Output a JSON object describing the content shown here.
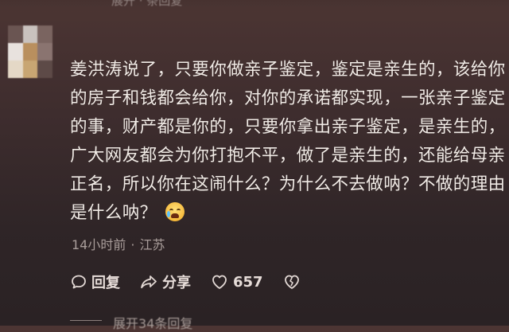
{
  "top_partial_text": "展开 · 条回复",
  "comment": {
    "lines": [
      "姜洪涛说了，只要你做亲子鉴定，鉴定是亲生的，该给你",
      "的房子和钱都会给你，对你的承诺都实现，一张亲子鉴定",
      "的事，财产都是你的，只要你拿出亲子鉴定，是亲生的，",
      "广大网友都会为你打抱不平，做了是亲生的，还能给母亲",
      "正名，所以你在这闹什么？为什么不去做呐？不做的理由",
      "是什么呐？"
    ],
    "emoji_icon": "crying-laughing-emoji"
  },
  "meta": {
    "time": "14小时前",
    "separator": "·",
    "location": "江苏"
  },
  "actions": {
    "reply_label": "回复",
    "share_label": "分享",
    "like_count": "657"
  },
  "expand_replies": "展开34条回复",
  "colors": {
    "background_top": "#4c3533",
    "background_bottom": "#2a2224",
    "text": "#f1ebe6",
    "meta_text": "#a99d9a"
  }
}
